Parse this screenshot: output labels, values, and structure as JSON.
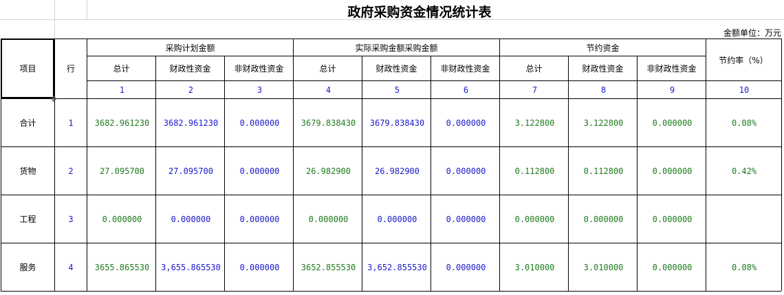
{
  "sheet": {
    "title": "政府采购资金情况统计表",
    "unit_label": "金额单位：万元",
    "headers": {
      "item": "项目",
      "row": "行",
      "plan_group": "采购计划金额",
      "actual_group": "实际采购金额采购金额",
      "savings_group": "节约资金",
      "savings_rate": "节约率（%）",
      "total": "总计",
      "fiscal": "财政性资金",
      "non_fiscal": "非财政性资金"
    },
    "column_numbers": [
      "1",
      "2",
      "3",
      "4",
      "5",
      "6",
      "7",
      "8",
      "9",
      "10"
    ],
    "rows": [
      {
        "item": "合计",
        "row": "1",
        "values": [
          "3682.961230",
          "3682.961230",
          "0.000000",
          "3679.838430",
          "3679.838430",
          "0.000000",
          "3.122800",
          "3.122800",
          "0.000000",
          "0.08%"
        ]
      },
      {
        "item": "货物",
        "row": "2",
        "values": [
          "27.095700",
          "27.095700",
          "0.000000",
          "26.982900",
          "26.982900",
          "0.000000",
          "0.112800",
          "0.112800",
          "0.000000",
          "0.42%"
        ]
      },
      {
        "item": "工程",
        "row": "3",
        "values": [
          "0.000000",
          "0.000000",
          "0.000000",
          "0.000000",
          "0.000000",
          "0.000000",
          "0.000000",
          "0.000000",
          "0.000000",
          ""
        ]
      },
      {
        "item": "服务",
        "row": "4",
        "values": [
          "3655.865530",
          "3,655.865530",
          "0.000000",
          "3652.855530",
          "3,652.855530",
          "0.000000",
          "3.010000",
          "3.010000",
          "0.000000",
          "0.08%"
        ]
      }
    ]
  },
  "colors": {
    "blue_text": "#1a1acc",
    "green_text": "#1e7a1e",
    "grid": "#d4d4d4"
  }
}
